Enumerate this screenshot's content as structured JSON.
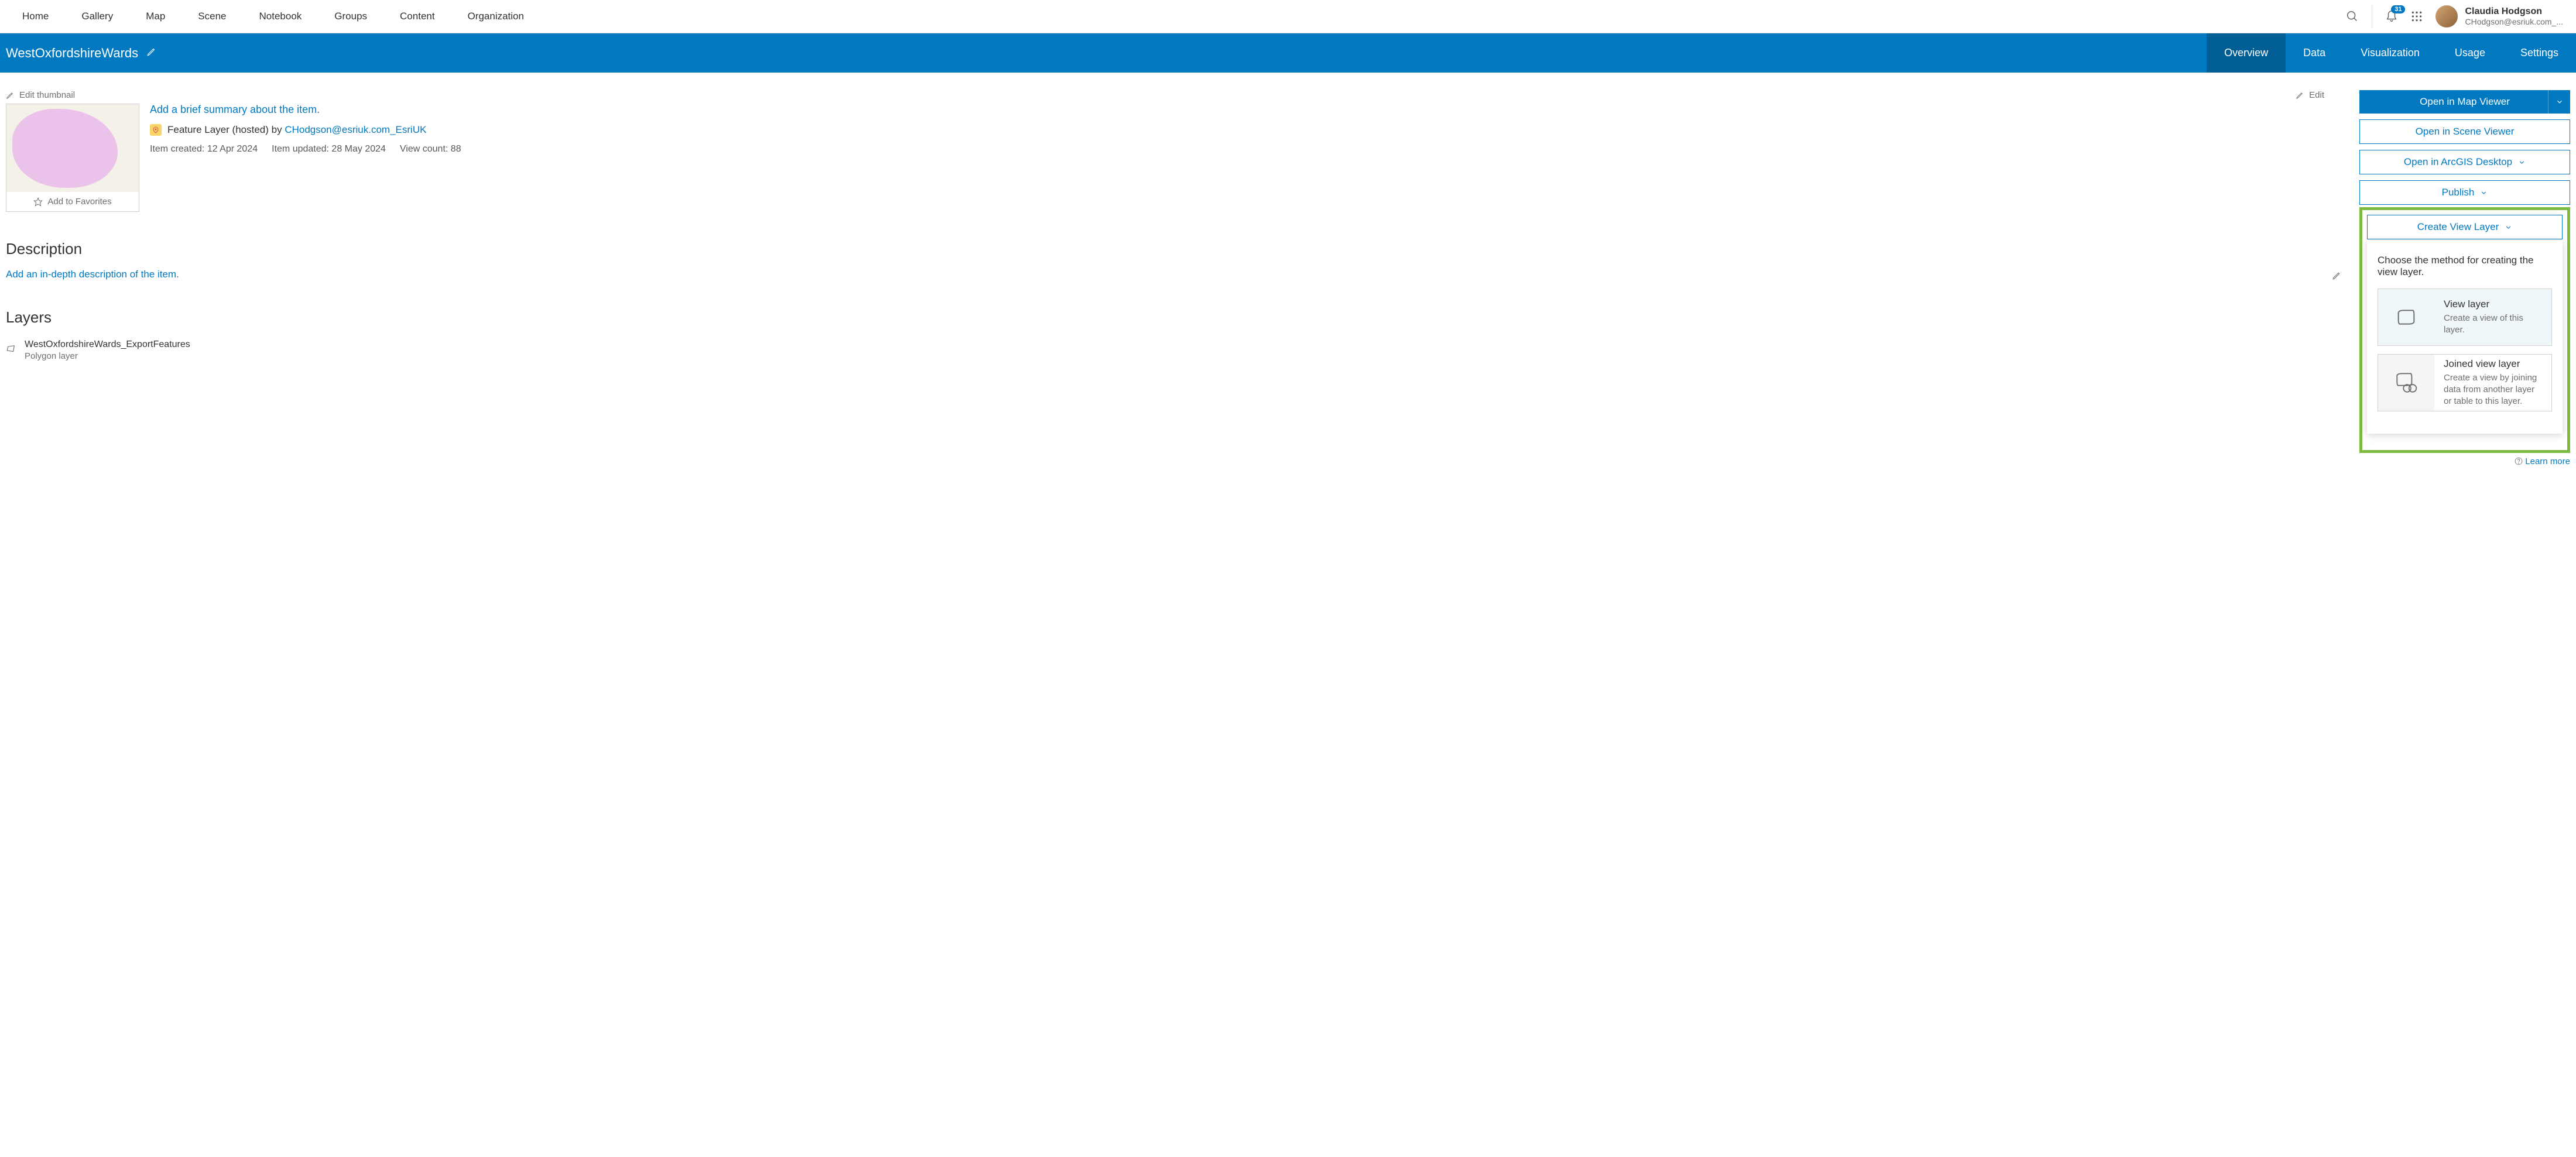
{
  "topnav": {
    "links": [
      "Home",
      "Gallery",
      "Map",
      "Scene",
      "Notebook",
      "Groups",
      "Content",
      "Organization"
    ],
    "notification_count": "31"
  },
  "user": {
    "name": "Claudia Hodgson",
    "email": "CHodgson@esriuk.com_..."
  },
  "titlebar": {
    "title": "WestOxfordshireWards",
    "tabs": [
      "Overview",
      "Data",
      "Visualization",
      "Usage",
      "Settings"
    ],
    "active_tab": "Overview"
  },
  "item": {
    "edit_thumbnail": "Edit thumbnail",
    "add_favorites": "Add to Favorites",
    "summary_prompt": "Add a brief summary about the item.",
    "type_prefix": "Feature Layer (hosted) by ",
    "owner": "CHodgson@esriuk.com_EsriUK",
    "created": "Item created: 12 Apr 2024",
    "updated": "Item updated: 28 May 2024",
    "view_count": "View count: 88",
    "edit_label": "Edit"
  },
  "description": {
    "heading": "Description",
    "prompt": "Add an in-depth description of the item."
  },
  "layers": {
    "heading": "Layers",
    "layer_name": "WestOxfordshireWards_ExportFeatures",
    "layer_type": "Polygon layer"
  },
  "actions": {
    "open_map_viewer": "Open in Map Viewer",
    "open_scene_viewer": "Open in Scene Viewer",
    "open_desktop": "Open in ArcGIS Desktop",
    "publish": "Publish",
    "create_view_layer": "Create View Layer"
  },
  "dropdown": {
    "title": "Choose the method for creating the view layer.",
    "option1_title": "View layer",
    "option1_desc": "Create a view of this layer.",
    "option2_title": "Joined view layer",
    "option2_desc": "Create a view by joining data from another layer or table to this layer."
  },
  "footer": {
    "learn_more": "Learn more"
  }
}
